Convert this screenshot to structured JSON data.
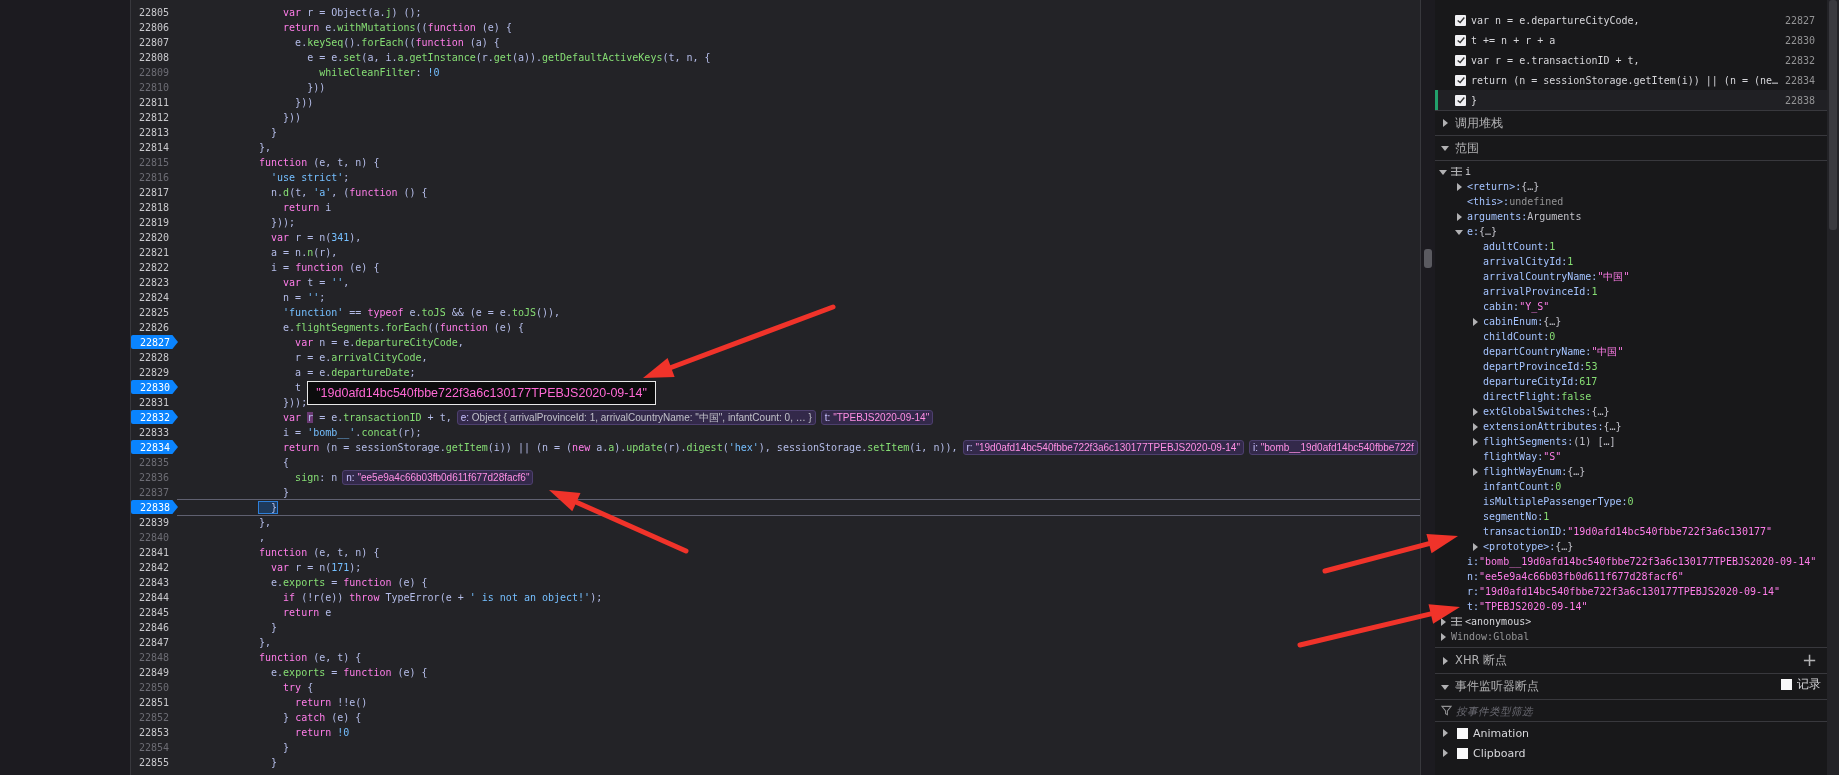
{
  "code": {
    "lines": [
      {
        "n": "22805",
        "breakpoint": false,
        "breakable": true,
        "segs": [
          {
            "kind": "k",
            "text": "    var"
          },
          {
            "kind": "t",
            "text": " r = Object(a."
          },
          {
            "kind": "p",
            "text": "j"
          },
          {
            "kind": "t",
            "text": ") ();"
          }
        ]
      },
      {
        "n": "22806",
        "breakpoint": false,
        "breakable": true,
        "segs": [
          {
            "kind": "k",
            "text": "    return"
          },
          {
            "kind": "t",
            "text": " e."
          },
          {
            "kind": "p",
            "text": "withMutations"
          },
          {
            "kind": "t",
            "text": "(("
          },
          {
            "kind": "k",
            "text": "function"
          },
          {
            "kind": "t",
            "text": " (e) {"
          }
        ]
      },
      {
        "n": "22807",
        "breakpoint": false,
        "breakable": true,
        "segs": [
          {
            "kind": "t",
            "text": "      e."
          },
          {
            "kind": "p",
            "text": "keySeq"
          },
          {
            "kind": "t",
            "text": "()."
          },
          {
            "kind": "p",
            "text": "forEach"
          },
          {
            "kind": "t",
            "text": "(("
          },
          {
            "kind": "k",
            "text": "function"
          },
          {
            "kind": "t",
            "text": " (a) {"
          }
        ]
      },
      {
        "n": "22808",
        "breakpoint": false,
        "breakable": true,
        "segs": [
          {
            "kind": "t",
            "text": "        e = e."
          },
          {
            "kind": "p",
            "text": "set"
          },
          {
            "kind": "t",
            "text": "(a, i."
          },
          {
            "kind": "p",
            "text": "a"
          },
          {
            "kind": "t",
            "text": "."
          },
          {
            "kind": "p",
            "text": "getInstance"
          },
          {
            "kind": "t",
            "text": "(r."
          },
          {
            "kind": "p",
            "text": "get"
          },
          {
            "kind": "t",
            "text": "(a))."
          },
          {
            "kind": "p",
            "text": "getDefaultActiveKeys"
          },
          {
            "kind": "t",
            "text": "(t, n, {"
          }
        ]
      },
      {
        "n": "22809",
        "breakpoint": false,
        "breakable": false,
        "segs": [
          {
            "kind": "p",
            "text": "          whileCleanFilter"
          },
          {
            "kind": "t",
            "text": ": "
          },
          {
            "kind": "s",
            "text": "!0"
          }
        ]
      },
      {
        "n": "22810",
        "breakpoint": false,
        "breakable": false,
        "segs": [
          {
            "kind": "t",
            "text": "        }))"
          }
        ]
      },
      {
        "n": "22811",
        "breakpoint": false,
        "breakable": true,
        "segs": [
          {
            "kind": "t",
            "text": "      }))"
          }
        ]
      },
      {
        "n": "22812",
        "breakpoint": false,
        "breakable": true,
        "segs": [
          {
            "kind": "t",
            "text": "    }))"
          }
        ]
      },
      {
        "n": "22813",
        "breakpoint": false,
        "breakable": true,
        "segs": [
          {
            "kind": "t",
            "text": "  }"
          }
        ]
      },
      {
        "n": "22814",
        "breakpoint": false,
        "breakable": true,
        "segs": [
          {
            "kind": "t",
            "text": "},"
          }
        ]
      },
      {
        "n": "22815",
        "breakpoint": false,
        "breakable": false,
        "segs": [
          {
            "kind": "k",
            "text": "function"
          },
          {
            "kind": "t",
            "text": " (e, t, n) {"
          }
        ]
      },
      {
        "n": "22816",
        "breakpoint": false,
        "breakable": false,
        "segs": [
          {
            "kind": "s",
            "text": "  'use strict'"
          },
          {
            "kind": "t",
            "text": ";"
          }
        ]
      },
      {
        "n": "22817",
        "breakpoint": false,
        "breakable": true,
        "segs": [
          {
            "kind": "t",
            "text": "  n."
          },
          {
            "kind": "p",
            "text": "d"
          },
          {
            "kind": "t",
            "text": "(t, "
          },
          {
            "kind": "s",
            "text": "'a'"
          },
          {
            "kind": "t",
            "text": ", ("
          },
          {
            "kind": "k",
            "text": "function"
          },
          {
            "kind": "t",
            "text": " () {"
          }
        ]
      },
      {
        "n": "22818",
        "breakpoint": false,
        "breakable": true,
        "segs": [
          {
            "kind": "k",
            "text": "    return"
          },
          {
            "kind": "t",
            "text": " i"
          }
        ]
      },
      {
        "n": "22819",
        "breakpoint": false,
        "breakable": true,
        "segs": [
          {
            "kind": "t",
            "text": "  }));"
          }
        ]
      },
      {
        "n": "22820",
        "breakpoint": false,
        "breakable": true,
        "segs": [
          {
            "kind": "k",
            "text": "  var"
          },
          {
            "kind": "t",
            "text": " r = n("
          },
          {
            "kind": "s",
            "text": "341"
          },
          {
            "kind": "t",
            "text": "),"
          }
        ]
      },
      {
        "n": "22821",
        "breakpoint": false,
        "breakable": true,
        "segs": [
          {
            "kind": "t",
            "text": "  a = n."
          },
          {
            "kind": "p",
            "text": "n"
          },
          {
            "kind": "t",
            "text": "(r),"
          }
        ]
      },
      {
        "n": "22822",
        "breakpoint": false,
        "breakable": true,
        "segs": [
          {
            "kind": "t",
            "text": "  i = "
          },
          {
            "kind": "k",
            "text": "function"
          },
          {
            "kind": "t",
            "text": " (e) {"
          }
        ]
      },
      {
        "n": "22823",
        "breakpoint": false,
        "breakable": true,
        "segs": [
          {
            "kind": "k",
            "text": "    var"
          },
          {
            "kind": "t",
            "text": " t = "
          },
          {
            "kind": "s",
            "text": "''"
          },
          {
            "kind": "t",
            "text": ","
          }
        ]
      },
      {
        "n": "22824",
        "breakpoint": false,
        "breakable": true,
        "segs": [
          {
            "kind": "t",
            "text": "    n = "
          },
          {
            "kind": "s",
            "text": "''"
          },
          {
            "kind": "t",
            "text": ";"
          }
        ]
      },
      {
        "n": "22825",
        "breakpoint": false,
        "breakable": true,
        "segs": [
          {
            "kind": "s",
            "text": "    'function'"
          },
          {
            "kind": "t",
            "text": " == "
          },
          {
            "kind": "k",
            "text": "typeof"
          },
          {
            "kind": "t",
            "text": " e."
          },
          {
            "kind": "p",
            "text": "toJS"
          },
          {
            "kind": "t",
            "text": " && (e = e."
          },
          {
            "kind": "p",
            "text": "toJS"
          },
          {
            "kind": "t",
            "text": "()),"
          }
        ]
      },
      {
        "n": "22826",
        "breakpoint": false,
        "breakable": true,
        "segs": [
          {
            "kind": "t",
            "text": "    e."
          },
          {
            "kind": "p",
            "text": "flightSegments"
          },
          {
            "kind": "t",
            "text": "."
          },
          {
            "kind": "p",
            "text": "forEach"
          },
          {
            "kind": "t",
            "text": "(("
          },
          {
            "kind": "k",
            "text": "function"
          },
          {
            "kind": "t",
            "text": " (e) {"
          }
        ]
      },
      {
        "n": "22827",
        "breakpoint": true,
        "breakable": true,
        "segs": [
          {
            "kind": "k",
            "text": "      var"
          },
          {
            "kind": "t",
            "text": " n = e."
          },
          {
            "kind": "p",
            "text": "departureCityCode"
          },
          {
            "kind": "t",
            "text": ","
          }
        ]
      },
      {
        "n": "22828",
        "breakpoint": false,
        "breakable": true,
        "segs": [
          {
            "kind": "t",
            "text": "      r = e."
          },
          {
            "kind": "p",
            "text": "arrivalCityCode"
          },
          {
            "kind": "t",
            "text": ","
          }
        ]
      },
      {
        "n": "22829",
        "breakpoint": false,
        "breakable": true,
        "segs": [
          {
            "kind": "t",
            "text": "      a = e."
          },
          {
            "kind": "p",
            "text": "departureDate"
          },
          {
            "kind": "t",
            "text": ";"
          }
        ]
      },
      {
        "n": "22830",
        "breakpoint": true,
        "breakable": true,
        "segs": [
          {
            "kind": "t",
            "text": "      t"
          }
        ],
        "tooltip": "\"19d0afd14bc540fbbe722f3a6c130177TPEBJS2020-09-14\""
      },
      {
        "n": "22831",
        "breakpoint": false,
        "breakable": true,
        "segs": [
          {
            "kind": "t",
            "text": "    }));"
          }
        ]
      },
      {
        "n": "22832",
        "breakpoint": true,
        "breakable": true,
        "segs": [
          {
            "kind": "k",
            "text": "    var "
          },
          {
            "kind": "h",
            "text": "r"
          },
          {
            "kind": "t",
            "text": " = e."
          },
          {
            "kind": "p",
            "text": "transactionID"
          },
          {
            "kind": "t",
            "text": " + t,"
          }
        ],
        "previews": [
          {
            "name": "e:",
            "value": "Object { arrivalProvinceId: 1, arrivalCountryName: \"中国\", infantCount: 0, … }",
            "kind": "object"
          },
          {
            "name": "t:",
            "value": "\"TPEBJS2020-09-14\"",
            "kind": "string"
          }
        ]
      },
      {
        "n": "22833",
        "breakpoint": false,
        "breakable": true,
        "segs": [
          {
            "kind": "t",
            "text": "    i = "
          },
          {
            "kind": "s",
            "text": "'bomb__'"
          },
          {
            "kind": "t",
            "text": "."
          },
          {
            "kind": "p",
            "text": "concat"
          },
          {
            "kind": "t",
            "text": "(r);"
          }
        ]
      },
      {
        "n": "22834",
        "breakpoint": true,
        "breakable": true,
        "segs": [
          {
            "kind": "k",
            "text": "    return"
          },
          {
            "kind": "t",
            "text": " (n = sessionStorage."
          },
          {
            "kind": "p",
            "text": "getItem"
          },
          {
            "kind": "t",
            "text": "(i)) || (n = ("
          },
          {
            "kind": "k",
            "text": "new"
          },
          {
            "kind": "t",
            "text": " a."
          },
          {
            "kind": "p",
            "text": "a"
          },
          {
            "kind": "t",
            "text": ")."
          },
          {
            "kind": "p",
            "text": "update"
          },
          {
            "kind": "t",
            "text": "(r)."
          },
          {
            "kind": "p",
            "text": "digest"
          },
          {
            "kind": "t",
            "text": "("
          },
          {
            "kind": "s",
            "text": "'hex'"
          },
          {
            "kind": "t",
            "text": "), sessionStorage."
          },
          {
            "kind": "p",
            "text": "setItem"
          },
          {
            "kind": "t",
            "text": "(i, n)),"
          }
        ],
        "previews": [
          {
            "name": "r:",
            "value": "\"19d0afd14bc540fbbe722f3a6c130177TPEBJS2020-09-14\"",
            "kind": "string"
          },
          {
            "name": "i:",
            "value": "\"bomb__19d0afd14bc540fbbe722f",
            "kind": "string"
          }
        ]
      },
      {
        "n": "22835",
        "breakpoint": false,
        "breakable": false,
        "segs": [
          {
            "kind": "t",
            "text": "    {"
          }
        ]
      },
      {
        "n": "22836",
        "breakpoint": false,
        "breakable": false,
        "segs": [
          {
            "kind": "p",
            "text": "      sign"
          },
          {
            "kind": "t",
            "text": ": n"
          }
        ],
        "previews": [
          {
            "name": "n:",
            "value": "\"ee5e9a4c66b03fb0d611f677d28facf6\"",
            "kind": "string"
          }
        ]
      },
      {
        "n": "22837",
        "breakpoint": false,
        "breakable": false,
        "segs": [
          {
            "kind": "t",
            "text": "    }"
          }
        ]
      },
      {
        "n": "22838",
        "breakpoint": true,
        "breakable": true,
        "current": true,
        "segs": [
          {
            "kind": "m",
            "text": "  }"
          }
        ]
      },
      {
        "n": "22839",
        "breakpoint": false,
        "breakable": true,
        "segs": [
          {
            "kind": "t",
            "text": "},"
          }
        ]
      },
      {
        "n": "22840",
        "breakpoint": false,
        "breakable": false,
        "segs": [
          {
            "kind": "t",
            "text": ","
          }
        ]
      },
      {
        "n": "22841",
        "breakpoint": false,
        "breakable": true,
        "segs": [
          {
            "kind": "k",
            "text": "function"
          },
          {
            "kind": "t",
            "text": " (e, t, n) {"
          }
        ]
      },
      {
        "n": "22842",
        "breakpoint": false,
        "breakable": true,
        "segs": [
          {
            "kind": "k",
            "text": "  var"
          },
          {
            "kind": "t",
            "text": " r = n("
          },
          {
            "kind": "s",
            "text": "171"
          },
          {
            "kind": "t",
            "text": ");"
          }
        ]
      },
      {
        "n": "22843",
        "breakpoint": false,
        "breakable": true,
        "segs": [
          {
            "kind": "t",
            "text": "  e."
          },
          {
            "kind": "p",
            "text": "exports"
          },
          {
            "kind": "t",
            "text": " = "
          },
          {
            "kind": "k",
            "text": "function"
          },
          {
            "kind": "t",
            "text": " (e) {"
          }
        ]
      },
      {
        "n": "22844",
        "breakpoint": false,
        "breakable": true,
        "segs": [
          {
            "kind": "k",
            "text": "    if"
          },
          {
            "kind": "t",
            "text": " (!r(e)) "
          },
          {
            "kind": "k",
            "text": "throw"
          },
          {
            "kind": "t",
            "text": " TypeError(e + "
          },
          {
            "kind": "s",
            "text": "' is not an object!'"
          },
          {
            "kind": "t",
            "text": ");"
          }
        ]
      },
      {
        "n": "22845",
        "breakpoint": false,
        "breakable": true,
        "segs": [
          {
            "kind": "k",
            "text": "    return"
          },
          {
            "kind": "t",
            "text": " e"
          }
        ]
      },
      {
        "n": "22846",
        "breakpoint": false,
        "breakable": true,
        "segs": [
          {
            "kind": "t",
            "text": "  }"
          }
        ]
      },
      {
        "n": "22847",
        "breakpoint": false,
        "breakable": true,
        "segs": [
          {
            "kind": "t",
            "text": "},"
          }
        ]
      },
      {
        "n": "22848",
        "breakpoint": false,
        "breakable": false,
        "segs": [
          {
            "kind": "k",
            "text": "function"
          },
          {
            "kind": "t",
            "text": " (e, t) {"
          }
        ]
      },
      {
        "n": "22849",
        "breakpoint": false,
        "breakable": true,
        "segs": [
          {
            "kind": "t",
            "text": "  e."
          },
          {
            "kind": "p",
            "text": "exports"
          },
          {
            "kind": "t",
            "text": " = "
          },
          {
            "kind": "k",
            "text": "function"
          },
          {
            "kind": "t",
            "text": " (e) {"
          }
        ]
      },
      {
        "n": "22850",
        "breakpoint": false,
        "breakable": false,
        "segs": [
          {
            "kind": "k",
            "text": "    try"
          },
          {
            "kind": "t",
            "text": " {"
          }
        ]
      },
      {
        "n": "22851",
        "breakpoint": false,
        "breakable": true,
        "segs": [
          {
            "kind": "k",
            "text": "      return"
          },
          {
            "kind": "t",
            "text": " !!e()"
          }
        ]
      },
      {
        "n": "22852",
        "breakpoint": false,
        "breakable": false,
        "segs": [
          {
            "kind": "t",
            "text": "    } "
          },
          {
            "kind": "k",
            "text": "catch"
          },
          {
            "kind": "t",
            "text": " (e) {"
          }
        ]
      },
      {
        "n": "22853",
        "breakpoint": false,
        "breakable": true,
        "segs": [
          {
            "kind": "k",
            "text": "      return "
          },
          {
            "kind": "s",
            "text": "!0"
          }
        ]
      },
      {
        "n": "22854",
        "breakpoint": false,
        "breakable": false,
        "segs": [
          {
            "kind": "t",
            "text": "    }"
          }
        ]
      },
      {
        "n": "22855",
        "breakpoint": false,
        "breakable": true,
        "segs": [
          {
            "kind": "t",
            "text": "  }"
          }
        ]
      }
    ]
  },
  "breakpoints": [
    {
      "code": "var n = e.departureCityCode,",
      "line": "22827",
      "checked": true,
      "paused": false
    },
    {
      "code": "t += n + r + a",
      "line": "22830",
      "checked": true,
      "paused": false
    },
    {
      "code": "var r = e.transactionID + t,",
      "line": "22832",
      "checked": true,
      "paused": false
    },
    {
      "code": "return (n = sessionStorage.getItem(i)) || (n = (ne…",
      "line": "22834",
      "checked": true,
      "paused": false
    },
    {
      "code": "}",
      "line": "22838",
      "checked": true,
      "paused": true
    }
  ],
  "sections": [
    {
      "label": "调用堆栈",
      "expanded": false
    },
    {
      "label": "范围",
      "expanded": true
    }
  ],
  "scope": {
    "items": [
      {
        "name": "i",
        "kind": "scope",
        "expanded": true,
        "children": [
          {
            "name": "<return>:",
            "value": "{…}",
            "kind": "object",
            "expanded": false
          },
          {
            "name": "<this>:",
            "value": "undefined",
            "kind": "undefined"
          },
          {
            "name": "arguments:",
            "value": "Arguments",
            "kind": "object",
            "expanded": false
          },
          {
            "name": "e:",
            "value": "{…}",
            "kind": "object",
            "expanded": true,
            "children": [
              {
                "name": "adultCount:",
                "value": "1",
                "kind": "number"
              },
              {
                "name": "arrivalCityId:",
                "value": "1",
                "kind": "number"
              },
              {
                "name": "arrivalCountryName:",
                "value": "\"中国\"",
                "kind": "string"
              },
              {
                "name": "arrivalProvinceId:",
                "value": "1",
                "kind": "number"
              },
              {
                "name": "cabin:",
                "value": "\"Y_S\"",
                "kind": "string"
              },
              {
                "name": "cabinEnum:",
                "value": "{…}",
                "kind": "object",
                "expanded": false
              },
              {
                "name": "childCount:",
                "value": "0",
                "kind": "number"
              },
              {
                "name": "departCountryName:",
                "value": "\"中国\"",
                "kind": "string"
              },
              {
                "name": "departProvinceId:",
                "value": "53",
                "kind": "number"
              },
              {
                "name": "departureCityId:",
                "value": "617",
                "kind": "number"
              },
              {
                "name": "directFlight:",
                "value": "false",
                "kind": "boolean"
              },
              {
                "name": "extGlobalSwitches:",
                "value": "{…}",
                "kind": "object",
                "expanded": false
              },
              {
                "name": "extensionAttributes:",
                "value": "{…}",
                "kind": "object",
                "expanded": false
              },
              {
                "name": "flightSegments:",
                "value": "(1) […]",
                "kind": "object",
                "expanded": false
              },
              {
                "name": "flightWay:",
                "value": "\"S\"",
                "kind": "string"
              },
              {
                "name": "flightWayEnum:",
                "value": "{…}",
                "kind": "object",
                "expanded": false
              },
              {
                "name": "infantCount:",
                "value": "0",
                "kind": "number"
              },
              {
                "name": "isMultiplePassengerType:",
                "value": "0",
                "kind": "number"
              },
              {
                "name": "segmentNo:",
                "value": "1",
                "kind": "number"
              },
              {
                "name": "transactionID:",
                "value": "\"19d0afd14bc540fbbe722f3a6c130177\"",
                "kind": "string"
              },
              {
                "name": "<prototype>:",
                "value": "{…}",
                "kind": "object",
                "expanded": false
              }
            ]
          },
          {
            "name": "i:",
            "value": "\"bomb__19d0afd14bc540fbbe722f3a6c130177TPEBJS2020-09-14\"",
            "kind": "string"
          },
          {
            "name": "n:",
            "value": "\"ee5e9a4c66b03fb0d611f677d28facf6\"",
            "kind": "string"
          },
          {
            "name": "r:",
            "value": "\"19d0afd14bc540fbbe722f3a6c130177TPEBJS2020-09-14\"",
            "kind": "string"
          },
          {
            "name": "t:",
            "value": "\"TPEBJS2020-09-14\"",
            "kind": "string"
          }
        ]
      },
      {
        "name": "<anonymous>",
        "kind": "scope",
        "expanded": false
      },
      {
        "name": "Window:",
        "value": "Global",
        "kind": "global",
        "expanded": false
      }
    ]
  },
  "xhr": {
    "label": "XHR 断点",
    "expanded": false,
    "add": "+"
  },
  "events": {
    "label": "事件监听器断点",
    "expanded": true,
    "log_label": "记录",
    "log_checked": false,
    "filter_placeholder": "按事件类型筛选",
    "items": [
      {
        "label": "Animation",
        "expanded": false,
        "checked": false
      },
      {
        "label": "Clipboard",
        "expanded": false,
        "checked": false
      }
    ]
  }
}
